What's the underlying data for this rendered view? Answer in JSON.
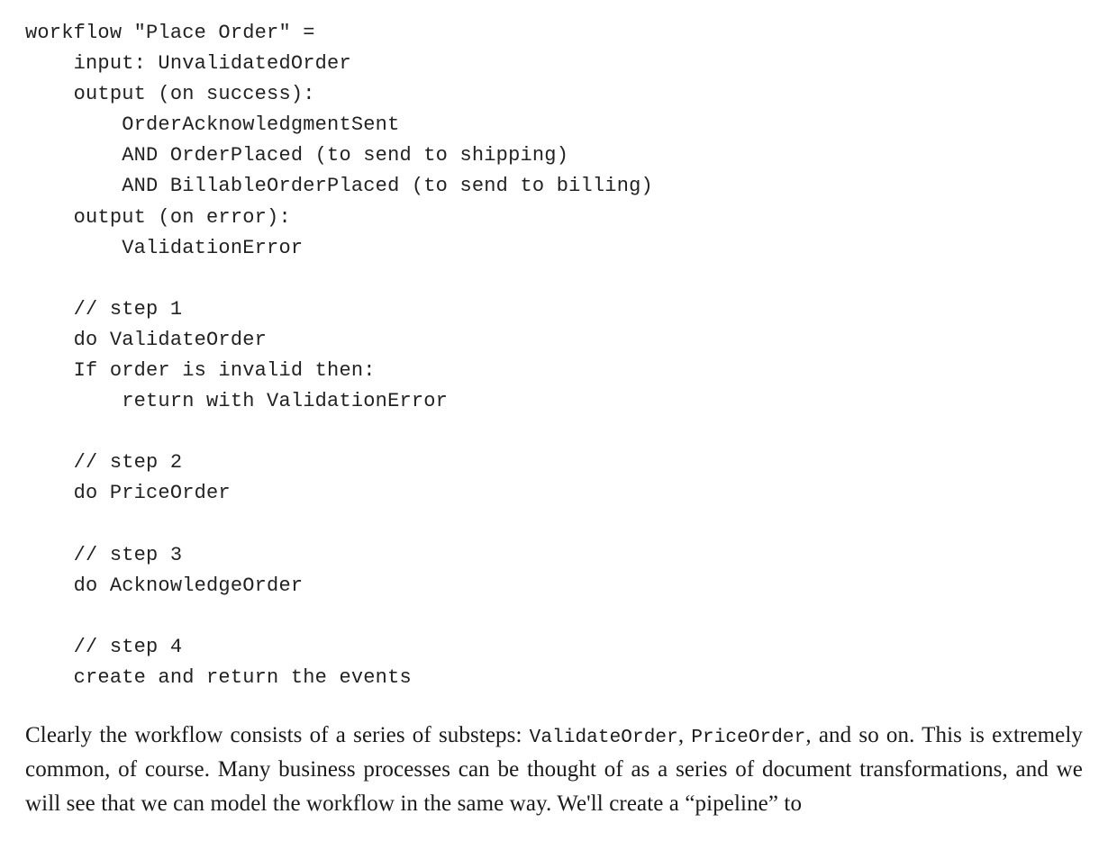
{
  "code": {
    "l01": "workflow \"Place Order\" =",
    "l02": "    input: UnvalidatedOrder",
    "l03": "    output (on success):",
    "l04": "        OrderAcknowledgmentSent",
    "l05": "        AND OrderPlaced (to send to shipping)",
    "l06": "        AND BillableOrderPlaced (to send to billing)",
    "l07": "    output (on error):",
    "l08": "        ValidationError",
    "l09": "",
    "l10": "    // step 1",
    "l11": "    do ValidateOrder",
    "l12": "    If order is invalid then:",
    "l13": "        return with ValidationError",
    "l14": "",
    "l15": "    // step 2",
    "l16": "    do PriceOrder",
    "l17": "",
    "l18": "    // step 3",
    "l19": "    do AcknowledgeOrder",
    "l20": "",
    "l21": "    // step 4",
    "l22": "    create and return the events"
  },
  "prose": {
    "part1": "Clearly the workflow consists of a series of substeps: ",
    "code1": "ValidateOrder",
    "part2": ", ",
    "code2": "PriceOrder",
    "part3": ", and so on. This is extremely common, of course. Many business processes can be thought of as a series of document transformations, and we will see that we can model the workflow in the same way. We'll create a “pipeline” to"
  }
}
